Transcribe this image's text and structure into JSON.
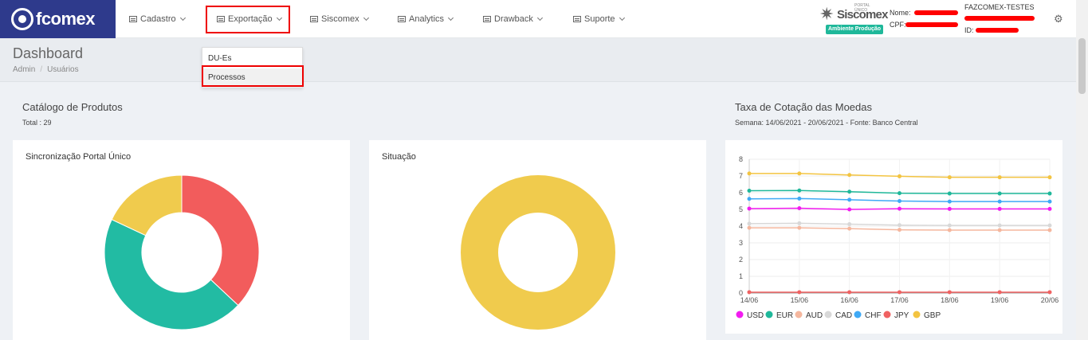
{
  "brand": {
    "name": "fcomex"
  },
  "nav": {
    "cadastro": "Cadastro",
    "exportacao": "Exportação",
    "siscomex": "Siscomex",
    "analytics": "Analytics",
    "drawback": "Drawback",
    "suporte": "Suporte"
  },
  "siscomex_logo": {
    "name": "Siscomex",
    "small": "PORTAL ÚNICO",
    "badge": "Ambiente Produção"
  },
  "user": {
    "nome_label": "Nome:",
    "cpf_label": "CPF:",
    "company": "FAZCOMEX-TESTES",
    "id_label": "ID:"
  },
  "header": {
    "title": "Dashboard",
    "crumb_admin": "Admin",
    "crumb_sep": "/",
    "crumb_users": "Usuários"
  },
  "dropdown": {
    "item1": "DU-Es",
    "item2": "Processos"
  },
  "catalog": {
    "title": "Catálogo de Produtos",
    "total": "Total : 29"
  },
  "rates": {
    "title": "Taxa de Cotação das Moedas",
    "subtitle": "Semana: 14/06/2021 - 20/06/2021 - Fonte: Banco Central"
  },
  "cards": {
    "sync_title": "Sincronização Portal Único",
    "status_title": "Situação"
  },
  "colors": {
    "red": "#f25c5c",
    "green": "#22bba3",
    "yellow": "#f0cb4d"
  },
  "chart_data": [
    {
      "type": "pie",
      "title": "Sincronização Portal Único",
      "values": [
        37,
        45,
        18
      ],
      "colors": [
        "#f25c5c",
        "#22bba3",
        "#f0cb4d"
      ]
    },
    {
      "type": "pie",
      "title": "Situação",
      "values": [
        100
      ],
      "colors": [
        "#f0cb4d"
      ]
    },
    {
      "type": "line",
      "title": "Taxa de Cotação das Moedas",
      "categories": [
        "14/06",
        "15/06",
        "16/06",
        "17/06",
        "18/06",
        "19/06",
        "20/06"
      ],
      "ylim": [
        0,
        8
      ],
      "yticks": [
        "0",
        "1",
        "2",
        "3",
        "4",
        "5",
        "6",
        "7",
        "8"
      ],
      "series": [
        {
          "name": "USD",
          "color": "#f21cf0",
          "values": [
            5.05,
            5.07,
            5.0,
            5.04,
            5.03,
            5.03,
            5.03
          ]
        },
        {
          "name": "EUR",
          "color": "#1fb89a",
          "values": [
            6.12,
            6.13,
            6.06,
            5.97,
            5.95,
            5.95,
            5.95
          ]
        },
        {
          "name": "AUD",
          "color": "#f5b79e",
          "values": [
            3.9,
            3.9,
            3.85,
            3.78,
            3.76,
            3.76,
            3.76
          ]
        },
        {
          "name": "CAD",
          "color": "#d8d8d8",
          "values": [
            4.15,
            4.17,
            4.12,
            4.06,
            4.04,
            4.04,
            4.04
          ]
        },
        {
          "name": "CHF",
          "color": "#3fa9f5",
          "values": [
            5.63,
            5.65,
            5.58,
            5.5,
            5.47,
            5.47,
            5.47
          ]
        },
        {
          "name": "JPY",
          "color": "#f06262",
          "values": [
            0.05,
            0.05,
            0.05,
            0.05,
            0.05,
            0.05,
            0.05
          ]
        },
        {
          "name": "GBP",
          "color": "#f3c441",
          "values": [
            7.15,
            7.15,
            7.06,
            6.98,
            6.92,
            6.92,
            6.92
          ]
        }
      ]
    }
  ]
}
